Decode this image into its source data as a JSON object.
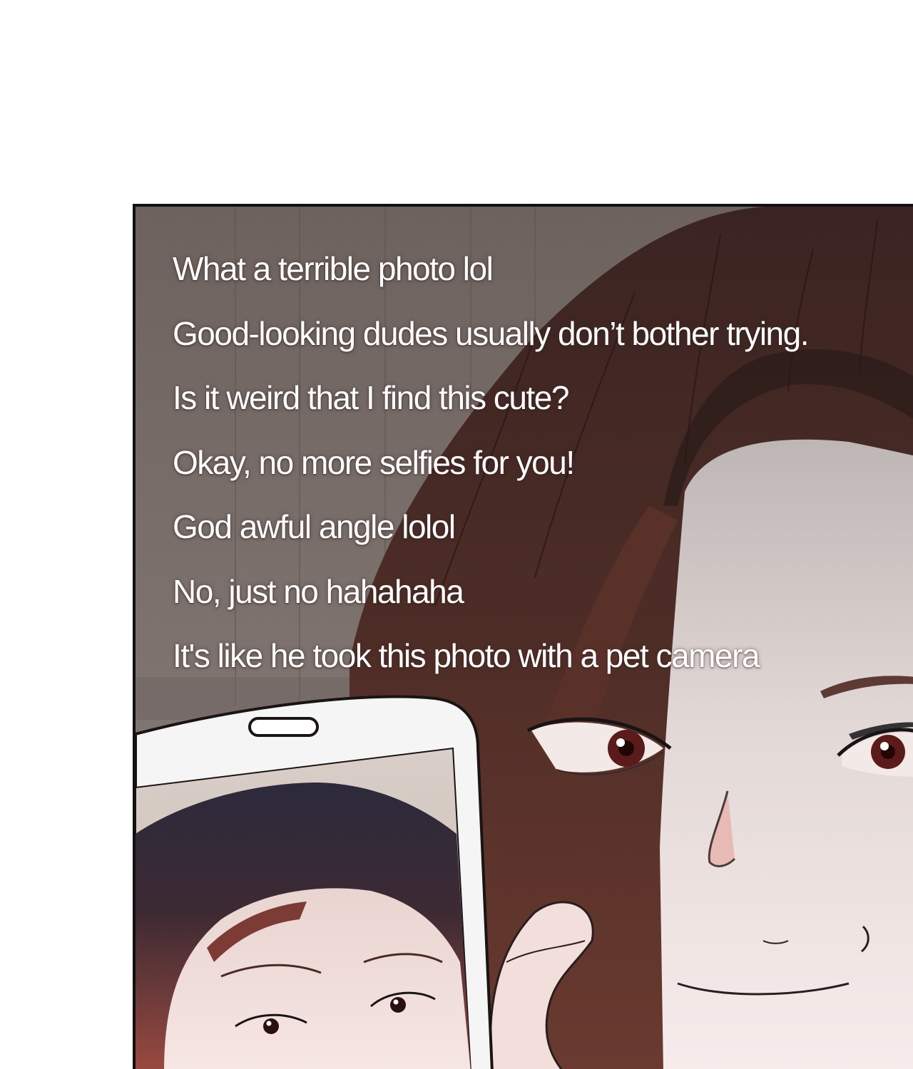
{
  "comments": [
    "What a terrible photo lol",
    "Good-looking dudes usually don’t bother trying.",
    "Is it weird that I find this cute?",
    "Okay, no more selfies for you!",
    "God awful angle lolol",
    "No, just no hahahaha",
    "It's like he took this photo with a pet camera"
  ]
}
